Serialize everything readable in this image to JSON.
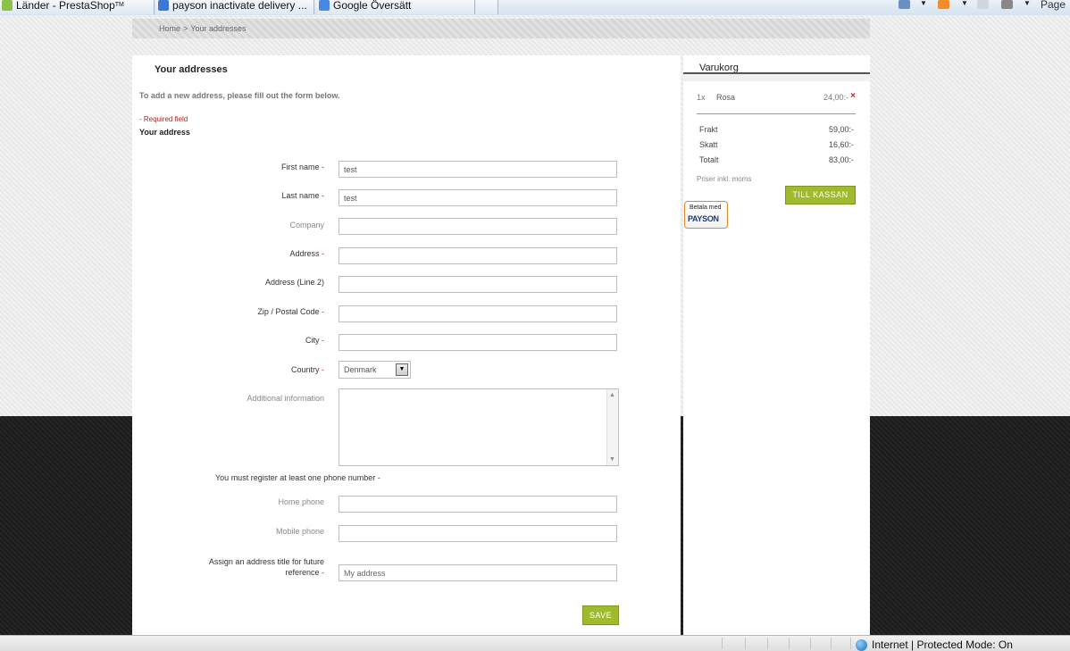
{
  "browser": {
    "tabs": [
      {
        "label": "Länder - PrestaShop",
        "mark": "TM",
        "icon": "prestashop-icon",
        "color": "#8bc34a"
      },
      {
        "label": "payson inactivate delivery ...",
        "icon": "google-icon",
        "color": "#3b78d8"
      },
      {
        "label": "Google Översätt",
        "icon": "translate-icon",
        "color": "#4a86e8"
      }
    ],
    "page_label": "Page",
    "status_zone": "Internet | Protected Mode: On"
  },
  "breadcrumb": {
    "home": "Home",
    "sep": ">",
    "current": "Your addresses"
  },
  "form": {
    "title": "Your addresses",
    "intro": "To add a new address, please fill out the form below.",
    "required_note": "- Required field",
    "subheading": "Your address",
    "fields": {
      "firstname": {
        "label": "First name",
        "value": "test",
        "required": true
      },
      "lastname": {
        "label": "Last name",
        "value": "test",
        "required": true
      },
      "company": {
        "label": "Company",
        "value": ""
      },
      "address1": {
        "label": "Address",
        "value": "",
        "required": true
      },
      "address2": {
        "label": "Address (Line 2)",
        "value": ""
      },
      "postcode": {
        "label": "Zip / Postal Code",
        "value": "",
        "required": true
      },
      "city": {
        "label": "City",
        "value": "",
        "required": true
      },
      "country": {
        "label": "Country",
        "value": "Denmark",
        "required": true
      },
      "other": {
        "label": "Additional information",
        "value": ""
      },
      "phone_home": {
        "label": "Home phone",
        "value": ""
      },
      "phone_mobile": {
        "label": "Mobile phone",
        "value": ""
      },
      "alias": {
        "label_line1": "Assign an address title for future",
        "label_line2": "reference",
        "value": "My address",
        "required": true
      }
    },
    "phone_note": "You must register at least one phone number",
    "required_mark": "-",
    "save_label": "SAVE"
  },
  "cart": {
    "title": "Varukorg",
    "items": [
      {
        "qty": "1x",
        "name": "Rosa",
        "price": "24,00:-"
      }
    ],
    "remove_mark": "×",
    "totals": [
      {
        "label": "Frakt",
        "value": "59,00:-"
      },
      {
        "label": "Skatt",
        "value": "16,60:-"
      },
      {
        "label": "Totalt",
        "value": "83,00:-"
      }
    ],
    "prices_note": "Priser inkl. moms",
    "checkout_label": "TILL KASSAN",
    "payson": {
      "line1": "Betala med",
      "line2": "PAYSON"
    }
  },
  "colors": {
    "accent_green": "#9fbb2d",
    "required_red": "#aa2222",
    "dark_band": "#1f1f1f"
  }
}
